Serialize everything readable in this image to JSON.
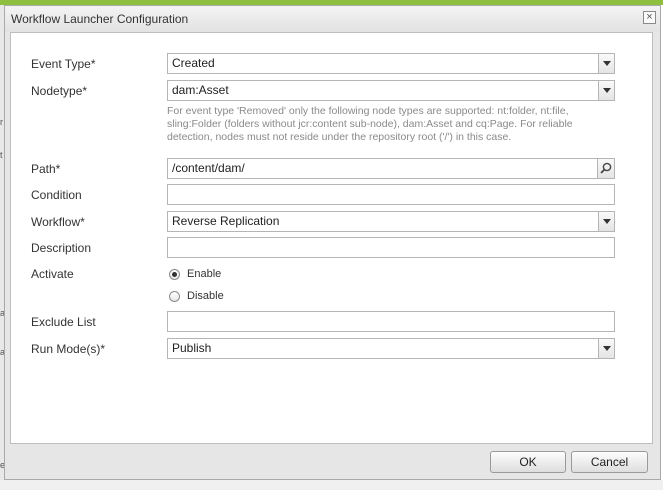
{
  "dialog": {
    "title": "Workflow Launcher Configuration",
    "close_glyph": "×"
  },
  "background": {
    "left_fragments": [
      "r",
      "t",
      "at",
      "at",
      "e"
    ]
  },
  "form": {
    "event_type": {
      "label": "Event Type*",
      "value": "Created"
    },
    "nodetype": {
      "label": "Nodetype*",
      "value": "dam:Asset",
      "hint_lines": [
        "For event type 'Removed' only the following node types are supported: nt:folder, nt:file,",
        "sling:Folder (folders without jcr:content sub-node), dam:Asset and cq:Page. For reliable",
        "detection, nodes must not reside under the repository root ('/') in this case."
      ]
    },
    "path": {
      "label": "Path*",
      "value": "/content/dam/"
    },
    "condition": {
      "label": "Condition",
      "value": ""
    },
    "workflow": {
      "label": "Workflow*",
      "value": "Reverse Replication"
    },
    "description": {
      "label": "Description",
      "value": ""
    },
    "activate": {
      "label": "Activate",
      "options": [
        {
          "label": "Enable",
          "selected": true
        },
        {
          "label": "Disable",
          "selected": false
        }
      ]
    },
    "exclude_list": {
      "label": "Exclude List",
      "value": ""
    },
    "run_modes": {
      "label": "Run Mode(s)*",
      "value": "Publish"
    }
  },
  "buttons": {
    "ok": "OK",
    "cancel": "Cancel"
  },
  "icons": {
    "search": "search-icon",
    "dropdown": "chevron-down-icon",
    "close": "close-icon"
  },
  "colors": {
    "accent": "#8fbf3f",
    "hint": "#8a8a8a"
  }
}
